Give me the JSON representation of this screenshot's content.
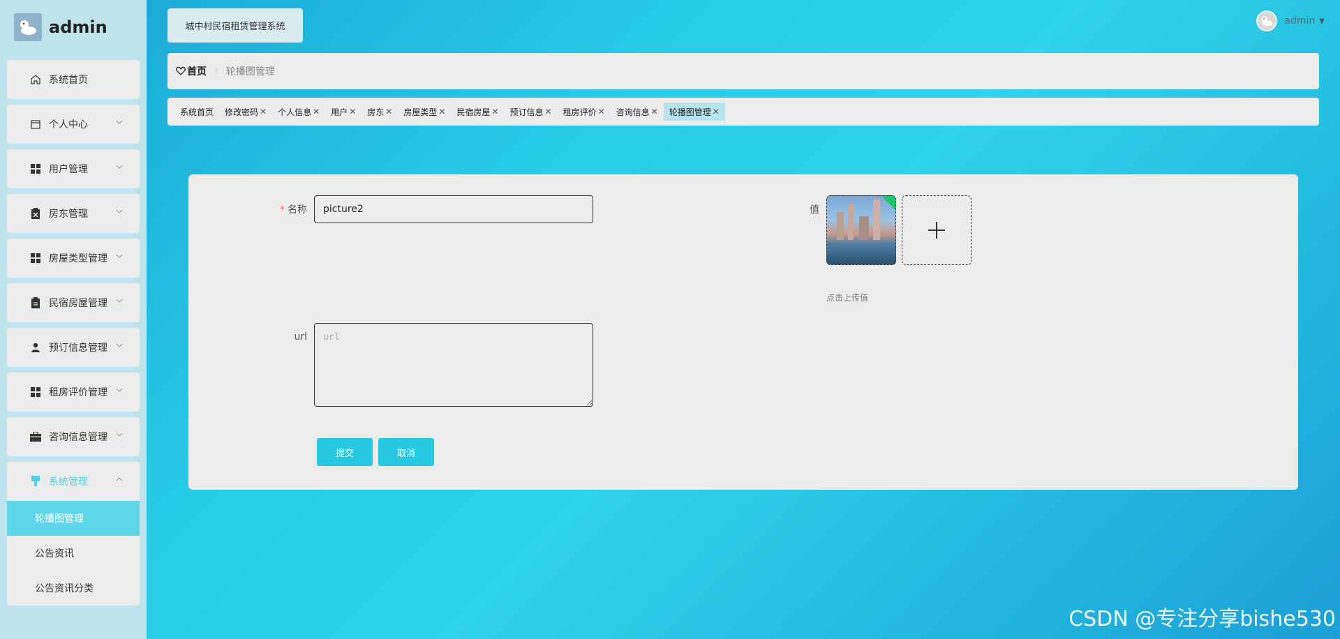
{
  "sidebar": {
    "brand_title": "admin",
    "menu": [
      {
        "label": "系统首页",
        "icon": "home-icon"
      },
      {
        "label": "个人中心",
        "icon": "calendar-icon"
      },
      {
        "label": "用户管理",
        "icon": "grid-icon"
      },
      {
        "label": "房东管理",
        "icon": "clipboard-x-icon"
      },
      {
        "label": "房屋类型管理",
        "icon": "grid-icon"
      },
      {
        "label": "民宿房屋管理",
        "icon": "clipboard-icon"
      },
      {
        "label": "预订信息管理",
        "icon": "user-icon"
      },
      {
        "label": "租房评价管理",
        "icon": "grid-icon"
      },
      {
        "label": "咨询信息管理",
        "icon": "briefcase-icon"
      },
      {
        "label": "系统管理",
        "icon": "brush-icon"
      }
    ],
    "submenu": [
      "轮播图管理",
      "公告资讯",
      "公告资讯分类"
    ]
  },
  "header": {
    "system_title": "城中村民宿租赁管理系统",
    "user_name": "admin"
  },
  "breadcrumb": {
    "home": "首页",
    "current": "轮播图管理"
  },
  "tags": [
    "系统首页",
    "修改密码",
    "个人信息",
    "用户",
    "房东",
    "房屋类型",
    "民宿房屋",
    "预订信息",
    "租房评价",
    "咨询信息",
    "轮播图管理"
  ],
  "form": {
    "name_label": "名称",
    "name_value": "picture2",
    "url_label": "url",
    "url_placeholder": "url",
    "value_label": "值",
    "upload_tip": "点击上传值",
    "submit_label": "提交",
    "cancel_label": "取消"
  },
  "watermark": "CSDN @专注分享bishe530",
  "colors": {
    "accent": "#27c8e2",
    "sidebar_bg": "#bfe3ec",
    "success": "#13ce66"
  }
}
